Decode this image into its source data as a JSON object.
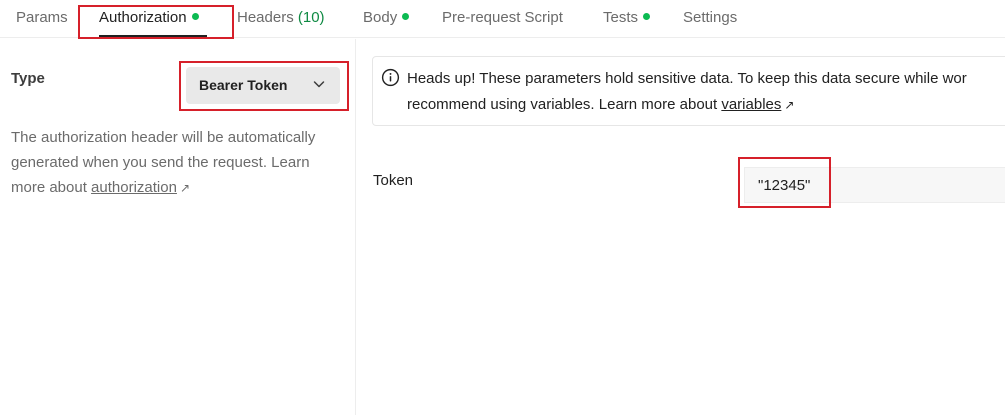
{
  "tabs": {
    "params": "Params",
    "authorization": "Authorization",
    "headers": "Headers",
    "headers_count": "(10)",
    "body": "Body",
    "prerequest": "Pre-request Script",
    "tests": "Tests",
    "settings": "Settings"
  },
  "auth": {
    "type_label": "Type",
    "type_value": "Bearer Token",
    "desc_line": "The authorization header will be automatically generated when you send the request. Learn more about ",
    "desc_link": "authorization"
  },
  "notice": {
    "line1": "Heads up! These parameters hold sensitive data. To keep this data secure while wor",
    "line2_prefix": "recommend using variables. Learn more about ",
    "line2_link": "variables"
  },
  "token": {
    "label": "Token",
    "value": "\"12345\""
  },
  "colors": {
    "accent_dot": "#0cbb52",
    "headers_count": "#0f8a43",
    "highlight_box": "#d6202a"
  },
  "icons": {
    "chevron": "chevron-down-icon",
    "info": "info-icon",
    "external": "external-link-icon"
  }
}
